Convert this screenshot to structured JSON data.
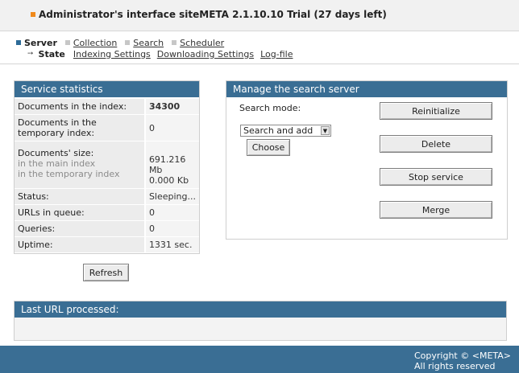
{
  "window": {
    "title": "Administrator's interface siteMETA 2.1.10.10 Trial (27 days left)"
  },
  "nav": {
    "main": [
      {
        "label": "Server",
        "active": true
      },
      {
        "label": "Collection",
        "active": false
      },
      {
        "label": "Search",
        "active": false
      },
      {
        "label": "Scheduler",
        "active": false
      }
    ],
    "sub": [
      {
        "label": "State",
        "active": true
      },
      {
        "label": "Indexing Settings",
        "active": false
      },
      {
        "label": "Downloading Settings",
        "active": false
      },
      {
        "label": "Log-file",
        "active": false
      }
    ]
  },
  "stats": {
    "title": "Service statistics",
    "rows": {
      "docs_index": {
        "label": "Documents in the index:",
        "value": "34300"
      },
      "docs_temp": {
        "label": "Documents in the temporary index:",
        "value": "0"
      },
      "docs_size": {
        "label": "Documents' size:",
        "sub1": "in the main index",
        "sub2": "in the temporary index",
        "value1": "691.216 Mb",
        "value2": "0.000 Kb"
      },
      "status": {
        "label": "Status:",
        "value": "Sleeping..."
      },
      "urls": {
        "label": "URLs in queue:",
        "value": "0"
      },
      "queries": {
        "label": "Queries:",
        "value": "0"
      },
      "uptime": {
        "label": "Uptime:",
        "value": "1331 sec."
      }
    },
    "refresh_label": "Refresh"
  },
  "manage": {
    "title": "Manage the search server",
    "mode_label": "Search mode:",
    "mode_value": "Search and add",
    "choose_label": "Choose",
    "buttons": {
      "reinit": "Reinitialize",
      "delete": "Delete",
      "stop": "Stop service",
      "merge": "Merge"
    }
  },
  "lasturl": {
    "title": "Last URL processed:"
  },
  "footer": {
    "copyright": "Copyright © <META>",
    "rights": "All rights reserved"
  },
  "colors": {
    "accent": "#3a6e94",
    "bullet": "#f08a1c"
  }
}
